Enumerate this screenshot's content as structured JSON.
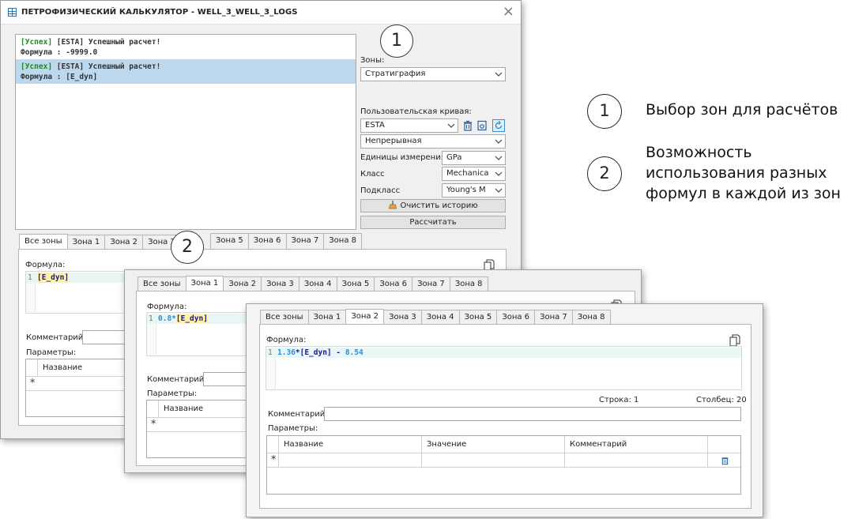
{
  "window": {
    "title": "ПЕТРОФИЗИЧЕСКИЙ КАЛЬКУЛЯТОР - WELL_3_WELL_3_LOGS",
    "close_glyph": "×"
  },
  "log": [
    {
      "status": "[Успех]",
      "message": "[ESTA] Успешный расчет!",
      "formula_label": "Формула :",
      "formula": "-9999.0",
      "selected": false
    },
    {
      "status": "[Успех]",
      "message": "[ESTA] Успешный расчет!",
      "formula_label": "Формула :",
      "formula": "[E_dyn]",
      "selected": true
    }
  ],
  "right_panel": {
    "zones_label": "Зоны:",
    "zones_value": "Стратиграфия",
    "custom_curve_label": "Пользовательская кривая:",
    "custom_curve_value": "ESTA",
    "curve_type_value": "Непрерывная",
    "units_label": "Единицы измерения:",
    "units_value": "GPa",
    "class_label": "Класс",
    "class_value": "Mechanica",
    "subclass_label": "Подкласс",
    "subclass_value": "Young's M",
    "clear_history_button": "Очистить историю",
    "calculate_button": "Рассчитать"
  },
  "tabs": [
    "Все зоны",
    "Зона 1",
    "Зона 2",
    "Зона 3",
    "Зона 4",
    "Зона 5",
    "Зона 6",
    "Зона 7",
    "Зона 8"
  ],
  "main_tabs_visible": [
    "Все зоны",
    "Зона 1",
    "Зона 2",
    "Зона 3"
  ],
  "main_tabs_tail": [
    "Зона 5",
    "Зона 6",
    "Зона 7",
    "Зона 8"
  ],
  "formula_label": "Формула:",
  "line_number": "1",
  "comment_label": "Комментарий:",
  "params_label": "Параметры:",
  "grid": {
    "col_name": "Название",
    "col_value": "Значение",
    "col_comment": "Комментарий",
    "new_row_marker": "∗"
  },
  "formulas": {
    "all_zones": "[E_dyn]",
    "zone1_coef": "0.8*",
    "zone1_ref": "[E_dyn]",
    "zone2_coef": "1.36",
    "zone2_mid": "*[E_dyn] - ",
    "zone2_const": "8.54"
  },
  "status": {
    "row_label": "Строка: 1",
    "col_label": "Столбец: 20"
  },
  "callouts": {
    "one": "1",
    "two": "2"
  },
  "annotations": [
    {
      "num": "1",
      "text": "Выбор зон для расчётов"
    },
    {
      "num": "2",
      "text_lines": [
        "Возможность",
        "использования разных",
        "формул в каждой из зон"
      ]
    }
  ],
  "colors": {
    "success_green": "#1e8a1e",
    "selection_blue": "#bcd8ee",
    "number_blue": "#2b8fd6",
    "code_navy": "#1a1a8c"
  }
}
